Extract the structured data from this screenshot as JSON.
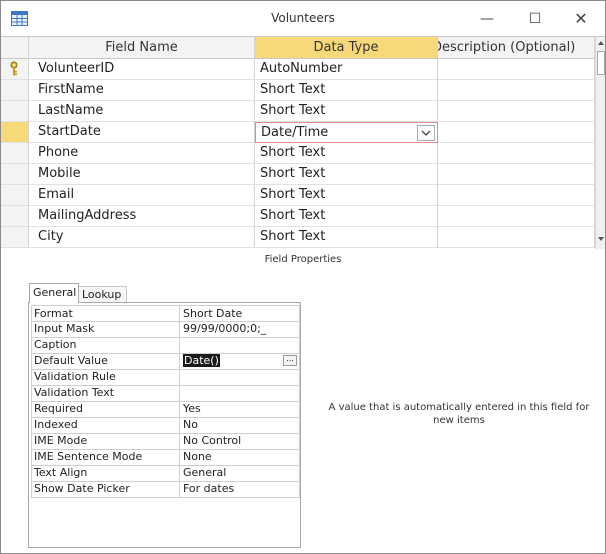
{
  "window": {
    "title": "Volunteers",
    "controls": {
      "minimize": "—",
      "maximize": "☐",
      "close": "✕"
    }
  },
  "grid": {
    "headers": {
      "field_name": "Field Name",
      "data_type": "Data Type",
      "description": "Description (Optional)"
    },
    "rows": [
      {
        "field_name": "VolunteerID",
        "data_type": "AutoNumber",
        "primary_key": true
      },
      {
        "field_name": "FirstName",
        "data_type": "Short Text"
      },
      {
        "field_name": "LastName",
        "data_type": "Short Text"
      },
      {
        "field_name": "StartDate",
        "data_type": "Date/Time",
        "selected": true
      },
      {
        "field_name": "Phone",
        "data_type": "Short Text"
      },
      {
        "field_name": "Mobile",
        "data_type": "Short Text"
      },
      {
        "field_name": "Email",
        "data_type": "Short Text"
      },
      {
        "field_name": "MailingAddress",
        "data_type": "Short Text"
      },
      {
        "field_name": "City",
        "data_type": "Short Text"
      }
    ]
  },
  "field_properties": {
    "title": "Field Properties",
    "tabs": {
      "general": "General",
      "lookup": "Lookup"
    },
    "properties": [
      {
        "name": "Format",
        "value": "Short Date"
      },
      {
        "name": "Input Mask",
        "value": "99/99/0000;0;_"
      },
      {
        "name": "Caption",
        "value": ""
      },
      {
        "name": "Default Value",
        "value": "Date()"
      },
      {
        "name": "Validation Rule",
        "value": ""
      },
      {
        "name": "Validation Text",
        "value": ""
      },
      {
        "name": "Required",
        "value": "Yes"
      },
      {
        "name": "Indexed",
        "value": "No"
      },
      {
        "name": "IME Mode",
        "value": "No Control"
      },
      {
        "name": "IME Sentence Mode",
        "value": "None"
      },
      {
        "name": "Text Align",
        "value": "General"
      },
      {
        "name": "Show Date Picker",
        "value": "For dates"
      }
    ],
    "build_button": "...",
    "help_text": "A value that is automatically entered in this field for new items"
  },
  "colors": {
    "selected_header": "#f7d97a",
    "editing_border": "#e08a8a",
    "highlight_bg": "#1a1a1a"
  }
}
